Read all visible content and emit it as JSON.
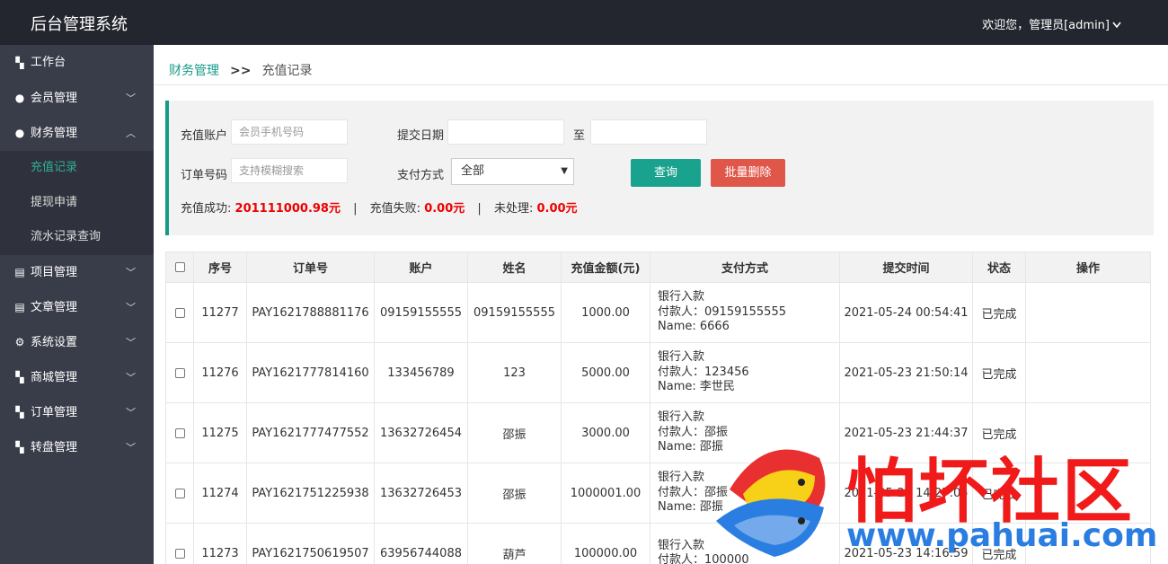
{
  "header": {
    "title": "后台管理系统",
    "user": "欢迎您，管理员[admin]"
  },
  "sidebar": {
    "items": [
      {
        "label": "工作台",
        "icon": "dashboard-icon"
      },
      {
        "label": "会员管理",
        "icon": "member-icon"
      },
      {
        "label": "财务管理",
        "icon": "finance-icon"
      },
      {
        "label": "项目管理",
        "icon": "doc-icon"
      },
      {
        "label": "文章管理",
        "icon": "doc-icon"
      },
      {
        "label": "系统设置",
        "icon": "gear-icon"
      },
      {
        "label": "商城管理",
        "icon": "dashboard-icon"
      },
      {
        "label": "订单管理",
        "icon": "dashboard-icon"
      },
      {
        "label": "转盘管理",
        "icon": "dashboard-icon"
      }
    ],
    "finance_sub": [
      "充值记录",
      "提现申请",
      "流水记录查询"
    ]
  },
  "breadcrumb": {
    "parent": "财务管理",
    "separator": ">>",
    "current": "充值记录"
  },
  "filters": {
    "account_label": "充值账户",
    "account_placeholder": "会员手机号码",
    "date_label": "提交日期",
    "date_to": "至",
    "order_label": "订单号码",
    "order_placeholder": "支持模糊搜索",
    "pay_label": "支付方式",
    "pay_selected": "全部",
    "query_button": "查询",
    "batch_delete_button": "批量删除"
  },
  "stats": {
    "success_label": "充值成功:",
    "success_value": "201111000.98元",
    "fail_label": "充值失败:",
    "fail_value": "0.00元",
    "pending_label": "未处理:",
    "pending_value": "0.00元",
    "separator": "|"
  },
  "table": {
    "headers": [
      "序号",
      "订单号",
      "账户",
      "姓名",
      "充值金额(元)",
      "支付方式",
      "提交时间",
      "状态",
      "操作"
    ],
    "rows": [
      {
        "id": "11277",
        "order": "PAY1621788881176",
        "account": "09159155555",
        "name": "09159155555",
        "amount": "1000.00",
        "pay1": "银行入款",
        "pay2": "付款人：09159155555",
        "pay3": "Name: 6666",
        "time": "2021-05-24 00:54:41",
        "status": "已完成"
      },
      {
        "id": "11276",
        "order": "PAY1621777814160",
        "account": "133456789",
        "name": "123",
        "amount": "5000.00",
        "pay1": "银行入款",
        "pay2": "付款人：123456",
        "pay3": "Name: 李世民",
        "time": "2021-05-23 21:50:14",
        "status": "已完成"
      },
      {
        "id": "11275",
        "order": "PAY1621777477552",
        "account": "13632726454",
        "name": "邵振",
        "amount": "3000.00",
        "pay1": "银行入款",
        "pay2": "付款人：邵振",
        "pay3": "Name: 邵振",
        "time": "2021-05-23 21:44:37",
        "status": "已完成"
      },
      {
        "id": "11274",
        "order": "PAY1621751225938",
        "account": "13632726453",
        "name": "邵振",
        "amount": "1000001.00",
        "pay1": "银行入款",
        "pay2": "付款人：邵振",
        "pay3": "Name: 邵振",
        "time": "2021-05-23 14:27:05",
        "status": "已完成"
      },
      {
        "id": "11273",
        "order": "PAY1621750619507",
        "account": "63956744088",
        "name": "葫芦",
        "amount": "100000.00",
        "pay1": "银行入款",
        "pay2": "付款人：100000",
        "pay3": "",
        "time": "2021-05-23 14:16:59",
        "status": "已完成"
      }
    ]
  },
  "watermark": {
    "cn": "怕坏社区",
    "url": "www.pahuai.com"
  }
}
